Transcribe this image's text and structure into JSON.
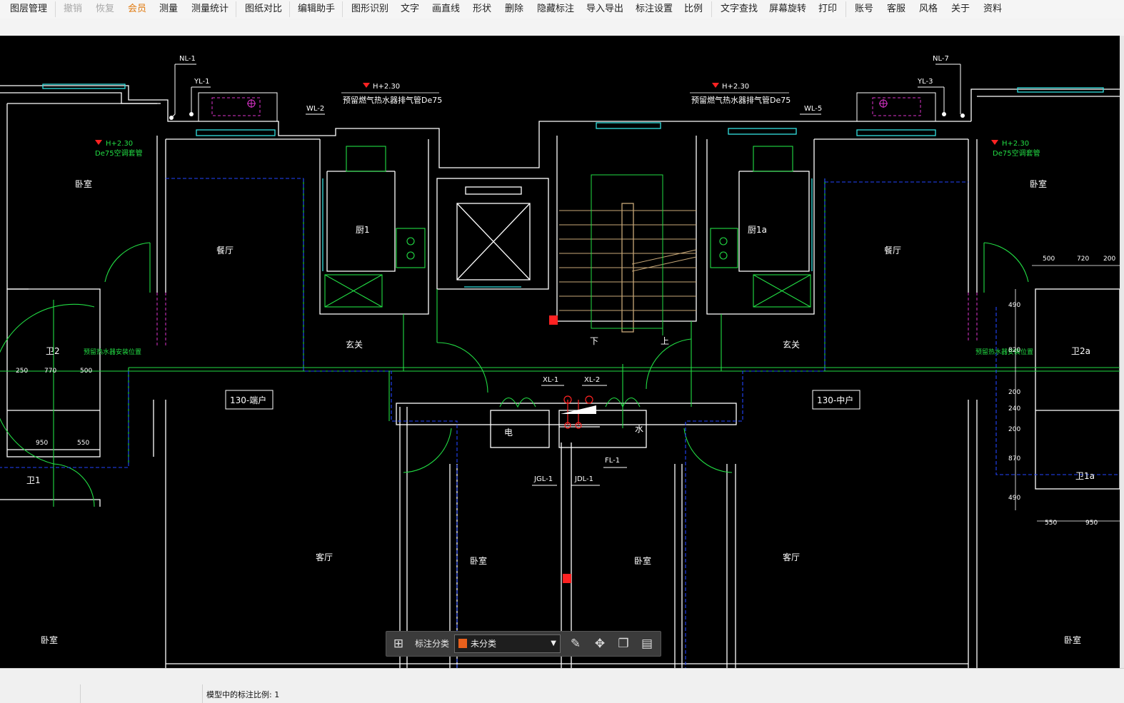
{
  "toolbar": {
    "items": [
      "图层管理",
      "撤销",
      "恢复",
      "会员",
      "测量",
      "测量统计",
      "图纸对比",
      "编辑助手",
      "图形识别",
      "文字",
      "画直线",
      "形状",
      "删除",
      "隐藏标注",
      "导入导出",
      "标注设置",
      "比例",
      "文字查找",
      "屏幕旋转",
      "打印",
      "账号",
      "客服",
      "风格",
      "关于",
      "资料"
    ]
  },
  "annotation_bar": {
    "label": "标注分类",
    "selected": "未分类",
    "swatch_color": "#e8601c",
    "icons": [
      "grid-icon",
      "edit-icon",
      "move-icon",
      "copy-icon",
      "paste-icon"
    ]
  },
  "status": {
    "scale_text": "模型中的标注比例: 1"
  },
  "colors": {
    "canvas": "#000000",
    "wall": "#ffffff",
    "green": "#22dd44",
    "blue": "#2244ff",
    "cyan": "#33e0e0",
    "magenta": "#dd33cc",
    "red": "#ff2222"
  },
  "drawing": {
    "rooms": [
      "卧室",
      "餐厅",
      "厨1",
      "厨1a",
      "餐厅",
      "卧室",
      "卫2",
      "卫2a",
      "玄关",
      "玄关",
      "卫1",
      "卫1a",
      "客厅",
      "卧室",
      "卧室",
      "客厅",
      "卧室",
      "卧室",
      "电",
      "水"
    ],
    "unit_labels": [
      "130-端户",
      "130-中户"
    ],
    "pipes": [
      "NL-1",
      "YL-1",
      "WL-2",
      "NL-7",
      "YL-3",
      "WL-5",
      "XL-1",
      "XL-2",
      "FL-1",
      "JGL-1",
      "JDL-1"
    ],
    "elev_notes": [
      "H+2.30",
      "H+2.30",
      "H+2.30",
      "H+2.30"
    ],
    "green_notes": [
      "De75空调套管",
      "预留燃气热水器排气管De75",
      "预留燃气热水器排气管De75",
      "De75空调套管",
      "预留热水器安装位置",
      "预留热水器安装位置"
    ],
    "stair_labels": [
      "下",
      "上"
    ],
    "dims": [
      "500",
      "720",
      "200",
      "490",
      "820",
      "200",
      "240",
      "200",
      "870",
      "490",
      "550",
      "950",
      "250",
      "770",
      "500",
      "950",
      "550"
    ]
  }
}
